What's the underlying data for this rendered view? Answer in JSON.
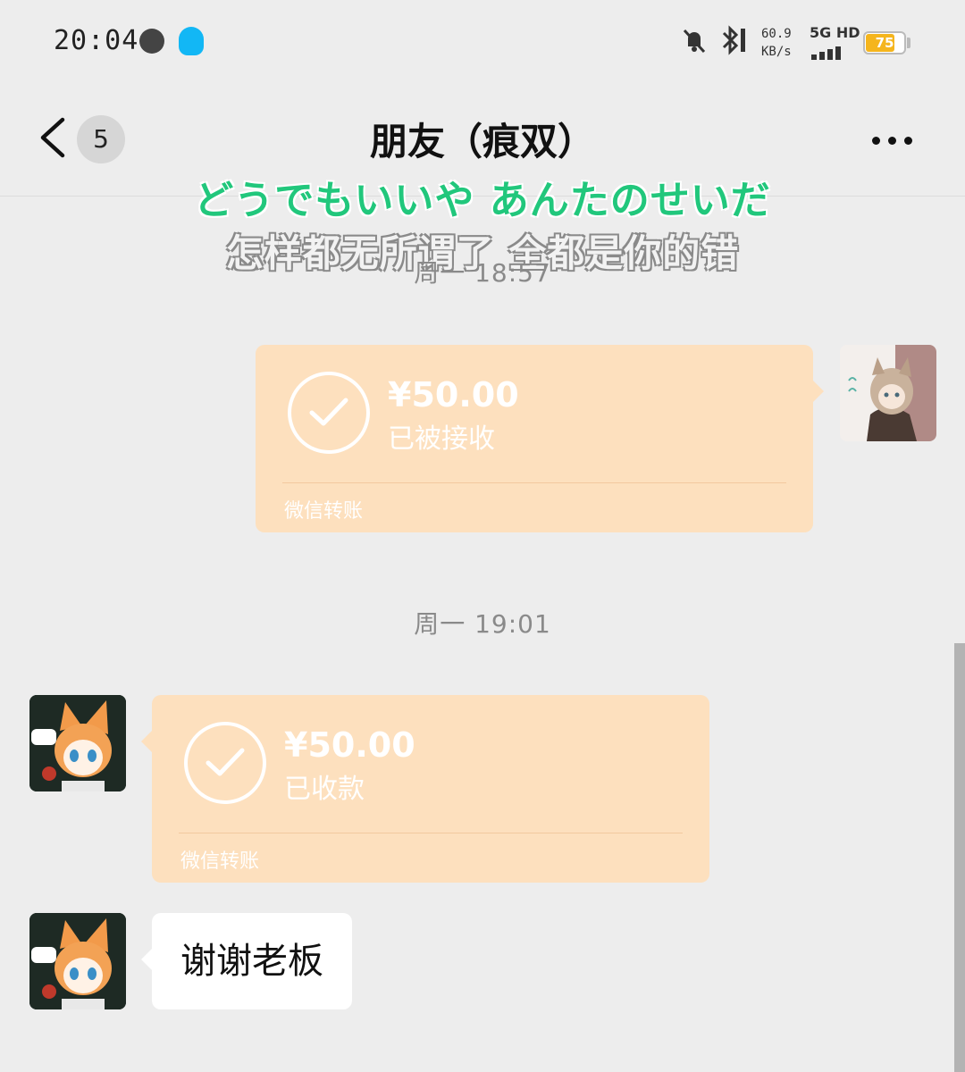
{
  "status_bar": {
    "time": "20:04",
    "net_speed": "60.9",
    "net_unit": "KB/s",
    "network": "5G HD",
    "battery": "75",
    "icons": [
      "app-icon",
      "qq-icon",
      "mute-bell-icon",
      "bluetooth-icon",
      "signal-icon",
      "battery-icon"
    ]
  },
  "nav": {
    "unread_count": "5",
    "title": "朋友（痕双）"
  },
  "lyric": {
    "japanese": "どうでもいいや あんたのせいだ",
    "chinese": "怎样都无所谓了 全都是你的错"
  },
  "messages": [
    {
      "timestamp": "周一 18:57",
      "type": "transfer",
      "sender": "self",
      "amount": "¥50.00",
      "status": "已被接收",
      "footer": "微信转账"
    },
    {
      "timestamp": "周一 19:01",
      "type": "transfer",
      "sender": "friend",
      "amount": "¥50.00",
      "status": "已收款",
      "footer": "微信转账"
    },
    {
      "type": "text",
      "sender": "friend",
      "text": "谢谢老板"
    }
  ],
  "colors": {
    "background": "#ededed",
    "transfer_card": "#fde0be",
    "lyric_green": "#21c77c",
    "battery": "#f5b51d"
  }
}
